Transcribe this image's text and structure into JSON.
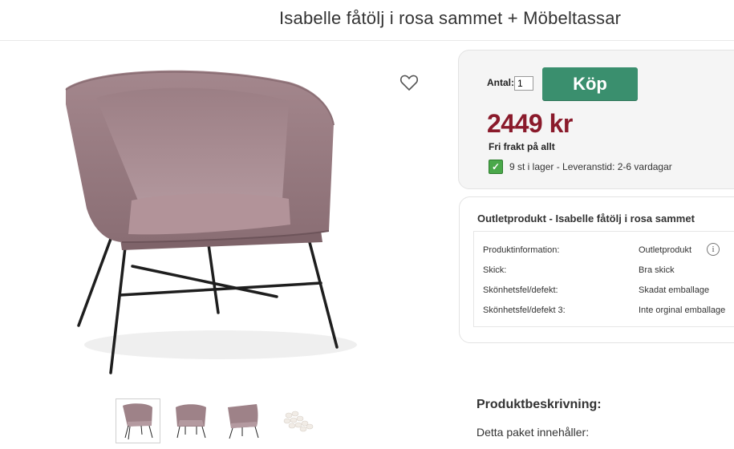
{
  "product": {
    "title": "Isabelle fåtölj i rosa sammet + Möbeltassar"
  },
  "gallery": {
    "thumbnails": [
      {
        "name": "Isabelle fåtölj vy 1"
      },
      {
        "name": "Isabelle fåtölj vy 2"
      },
      {
        "name": "Isabelle fåtölj vy 3"
      },
      {
        "name": "Möbeltassar"
      }
    ],
    "favorite_icon": "heart-outline-icon"
  },
  "buy": {
    "quantity_label": "Antal:",
    "quantity_value": "1",
    "button_label": "Köp",
    "price": "2449 kr",
    "shipping": "Fri frakt på allt",
    "stock": "9 st i lager - Leveranstid: 2-6 vardagar",
    "colors": {
      "buy_button": "#3a8f6e",
      "price": "#8a1a2b",
      "stock_check": "#4aa84a"
    }
  },
  "outlet": {
    "title": "Outletprodukt - Isabelle fåtölj i rosa sammet",
    "rows": [
      {
        "key": "Produktinformation:",
        "value": "Outletprodukt"
      },
      {
        "key": "Skick:",
        "value": "Bra skick"
      },
      {
        "key": "Skönhetsfel/defekt:",
        "value": "Skadat emballage"
      },
      {
        "key": "Skönhetsfel/defekt 3:",
        "value": "Inte orginal emballage"
      }
    ]
  },
  "description": {
    "heading": "Produktbeskrivning:",
    "intro": "Detta paket innehåller:"
  }
}
